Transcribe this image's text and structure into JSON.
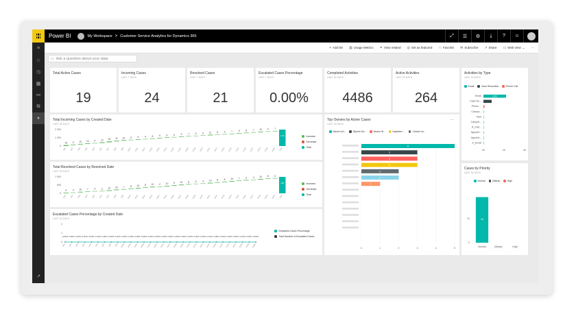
{
  "topbar": {
    "brand": "Power BI",
    "workspace": "My Workspace",
    "separator": ">",
    "report": "Customer Service Analytics for Dynamics 365"
  },
  "actions": [
    {
      "icon": "plus-icon",
      "label": "Add tile"
    },
    {
      "icon": "chart-icon",
      "label": "Usage Metrics"
    },
    {
      "icon": "link-icon",
      "label": "View related"
    },
    {
      "icon": "pin-icon",
      "label": "Set as featured"
    },
    {
      "icon": "star-icon",
      "label": "Favorite"
    },
    {
      "icon": "mail-icon",
      "label": "Subscribe"
    },
    {
      "icon": "share-icon",
      "label": "Share"
    },
    {
      "icon": "monitor-icon",
      "label": "Web view"
    }
  ],
  "qna": {
    "placeholder": "Ask a question about your data"
  },
  "kpis": [
    {
      "title": "Total Active Cases",
      "subtitle": "",
      "value": "19"
    },
    {
      "title": "Incoming Cases",
      "subtitle": "LAST 7 DAYS",
      "value": "24"
    },
    {
      "title": "Resolved Cases",
      "subtitle": "LAST 7 DAYS",
      "value": "21"
    },
    {
      "title": "Escalated Cases Percentage",
      "subtitle": "LAST 7 DAYS",
      "value": "0.00%"
    },
    {
      "title": "Completed Activities",
      "subtitle": "LAST 30 DAYS",
      "value": "4486"
    },
    {
      "title": "Active Activities",
      "subtitle": "LAST 30 DAYS",
      "value": "264"
    }
  ],
  "incoming_tile": {
    "title": "Total Incoming Cases by Created Date",
    "subtitle": "LAST 30 DAYS",
    "legend": [
      "Increase",
      "Decrease",
      "Total"
    ],
    "colors": {
      "increase": "#5cb85c",
      "decrease": "#e0533a",
      "total": "#01b8aa"
    }
  },
  "resolved_tile": {
    "title": "Total Resolved Cases by Resolved Date",
    "subtitle": "LAST 30 DAYS",
    "legend": [
      "Increase",
      "Decrease",
      "Total"
    ]
  },
  "escalated_tile": {
    "title": "Escalated Cases Percentage by Created Date",
    "subtitle": "LAST 30 DAYS",
    "legend": [
      "Escalated Cases Percentage",
      "Total Number of Escalated Cases"
    ],
    "colors": {
      "pct": "#01b8aa",
      "total": "#333333"
    }
  },
  "owners_tile": {
    "title": "Top Owners by Active Cases",
    "subtitle": "LAST 30 DAYS",
    "legend": [
      "Naomi Lef...",
      "Dipesh Da...",
      "Moses W...",
      "Nayibeko ...",
      "Christo Va..."
    ],
    "legend_colors": [
      "#01b8aa",
      "#374649",
      "#fd625e",
      "#f2c80f",
      "#5f6b6d"
    ],
    "more": "..."
  },
  "activities_tile": {
    "title": "Activities by Type",
    "subtitle": "LAST 30 DAYS",
    "legend": [
      "Email",
      "Case Resolution",
      "Phone Call"
    ],
    "legend_colors": [
      "#01b8aa",
      "#374649",
      "#fd625e"
    ]
  },
  "priority_tile": {
    "title": "Cases by Priority",
    "subtitle": "LAST 30 DAYS",
    "legend": [
      "Normal",
      "(Blank)",
      "High"
    ],
    "legend_colors": [
      "#01b8aa",
      "#374649",
      "#fd625e"
    ]
  },
  "chart_data": [
    {
      "type": "bar",
      "title": "Total Incoming Cases by Created Date",
      "ylim": [
        0,
        2000
      ],
      "yticks": [
        "2 000",
        "1 000",
        "0"
      ],
      "data_labels": [
        "15",
        "9",
        "10",
        "10",
        "4",
        "12",
        "15",
        "11",
        "10",
        "5",
        "9",
        "4",
        "8",
        "9",
        "9",
        "5",
        "9",
        "7",
        "5",
        "5",
        "11",
        "6",
        "3",
        "7",
        "9",
        "8",
        "7",
        "10",
        "4",
        "7"
      ],
      "total_label": "1 06"
    },
    {
      "type": "bar",
      "title": "Total Resolved Cases by Resolved Date",
      "ylim": [
        0,
        1000
      ],
      "yticks": [
        "1 000",
        "500",
        "0"
      ],
      "data_labels": [
        "9",
        "4",
        "10",
        "7",
        "4",
        "2",
        "10",
        "10",
        "7",
        "8",
        "10",
        "8",
        "10",
        "2",
        "10",
        "9",
        "10",
        "8",
        "5",
        "4",
        "10",
        "8",
        "8",
        "10",
        "7",
        "9",
        "4",
        "10",
        "8",
        "3"
      ],
      "total_label": "103"
    },
    {
      "type": "line",
      "title": "Escalated Cases Percentage by Created Date",
      "yticks": [
        "2",
        "1",
        "0"
      ],
      "data_labels": [
        "0.00%",
        "0.00%",
        "0.00%",
        "0.00%",
        "0.00%",
        "0.00%",
        "0.00%",
        "0.00%",
        "0.00%",
        "0.00%",
        "0.00%",
        "0.00%",
        "0.00%",
        "0.00%",
        "0.00%",
        "0.00%",
        "0.00%",
        "0.00%",
        "0.00%",
        "0.00%",
        "0.00%",
        "0.00%",
        "0.00%",
        "0.00%",
        "0.00%",
        "0.00%",
        "0.00%",
        "0.00%",
        "0.00%",
        "0.00%"
      ]
    },
    {
      "type": "bar",
      "title": "Top Owners by Active Cases",
      "orientation": "horizontal",
      "xticks": [
        "0",
        "1",
        "2",
        "3",
        "4",
        "5"
      ],
      "xlim": [
        0,
        5
      ],
      "series": [
        {
          "name": "Naomi Lef...",
          "value": 5,
          "color": "#01b8aa"
        },
        {
          "name": "Dipesh Da...",
          "value": 3,
          "color": "#374649"
        },
        {
          "name": "Moses W...",
          "value": 3,
          "color": "#fd625e"
        },
        {
          "name": "Nayibeko ...",
          "value": 3,
          "color": "#f2c80f"
        },
        {
          "name": "Christo Va...",
          "value": 2,
          "color": "#5f6b6d"
        },
        {
          "name": "",
          "value": 2,
          "color": "#8ad4eb"
        },
        {
          "name": "",
          "value": 1,
          "color": "#fe9666"
        }
      ],
      "data_labels": [
        "5",
        "3",
        "3",
        "3",
        "2",
        "2",
        "1"
      ]
    },
    {
      "type": "bar",
      "title": "Activities by Type",
      "orientation": "horizontal",
      "categories": [
        "Email",
        "Case Re...",
        "Phone ...",
        "Campa...",
        "Task",
        "Campai...",
        "R_mail...",
        "Appoint...",
        "Appoint...",
        "E_Email"
      ],
      "values": [
        2200,
        800,
        100,
        0,
        0,
        0,
        0,
        0,
        0,
        0
      ],
      "colors": [
        "#01b8aa",
        "#374649",
        "#fd625e",
        "#01b8aa",
        "#01b8aa",
        "#01b8aa",
        "#01b8aa",
        "#01b8aa",
        "#01b8aa",
        "#01b8aa"
      ],
      "data_labels": [
        "2.2K",
        "",
        "",
        "",
        "",
        "",
        "",
        "",
        "",
        ""
      ],
      "xticks": [
        "0K",
        "2K",
        "4K"
      ],
      "xlim": [
        0,
        4000
      ]
    },
    {
      "type": "bar",
      "title": "Cases by Priority",
      "categories": [
        "Normal",
        "(Blank)",
        "High"
      ],
      "values": [
        19,
        0,
        0
      ],
      "yticks": [
        "10",
        "0"
      ],
      "ylim": [
        0,
        20
      ],
      "data_labels": [
        "19"
      ]
    }
  ]
}
